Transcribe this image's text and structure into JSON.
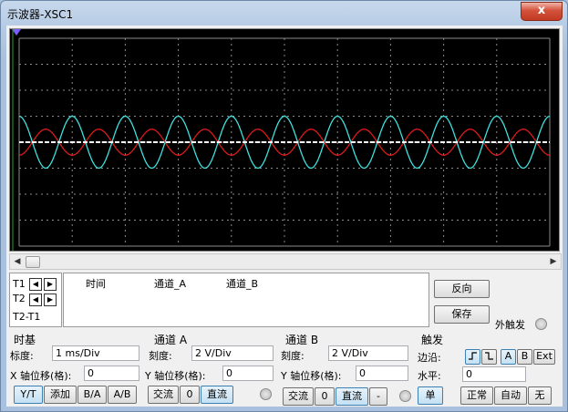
{
  "window": {
    "title": "示波器-XSC1",
    "close_label": "x"
  },
  "screen": {
    "background": "#000000",
    "grid_color": "#8a8a8a",
    "divisions_x": 10,
    "divisions_y": 8,
    "trace_a_color": "#e01a1a",
    "trace_b_color": "#3fe0e0",
    "center_line_color": "#ffffff",
    "marker_color": "#7a5cff"
  },
  "chart_data": {
    "type": "line",
    "timebase": "1 ms/Div",
    "x_range_div": [
      0,
      10
    ],
    "y_range_div": [
      -4,
      4
    ],
    "series": [
      {
        "name": "通道_A",
        "scale": "2 V/Div",
        "amplitude_div": 0.5,
        "cycles": 10,
        "phase_deg": 180
      },
      {
        "name": "通道_B",
        "scale": "2 V/Div",
        "amplitude_div": 1.0,
        "cycles": 10,
        "phase_deg": 0
      }
    ]
  },
  "cursors": {
    "t1": "T1",
    "t2": "T2",
    "t2_t1": "T2-T1",
    "left_arrow": "◀",
    "right_arrow": "▶"
  },
  "readout": {
    "time": "时间",
    "channel_a": "通道_A",
    "channel_b": "通道_B"
  },
  "side_buttons": {
    "reverse": "反向",
    "save": "保存",
    "ext_trigger": "外触发"
  },
  "timebase": {
    "title": "时基",
    "scale_label": "标度:",
    "scale_value": "1 ms/Div",
    "xpos_label": "X 轴位移(格):",
    "xpos_value": "0",
    "modes": [
      "Y/T",
      "添加",
      "B/A",
      "A/B"
    ],
    "selected_mode": "Y/T"
  },
  "channel_a": {
    "title": "通道 A",
    "scale_label": "刻度:",
    "scale_value": "2  V/Div",
    "ypos_label": "Y 轴位移(格):",
    "ypos_value": "0",
    "coupling": [
      "交流",
      "0",
      "直流"
    ],
    "selected": "直流"
  },
  "channel_b": {
    "title": "通道 B",
    "scale_label": "刻度:",
    "scale_value": "2  V/Div",
    "ypos_label": "Y 轴位移(格):",
    "ypos_value": "0",
    "coupling": [
      "交流",
      "0",
      "直流",
      "-"
    ],
    "selected": "直流"
  },
  "trigger": {
    "title": "触发",
    "edge_label": "边沿:",
    "level_label": "水平:",
    "level_value": "0",
    "source_buttons": [
      "A",
      "B",
      "Ext"
    ],
    "selected_source": "A",
    "modes": [
      "单",
      "正常",
      "自动",
      "无"
    ]
  }
}
